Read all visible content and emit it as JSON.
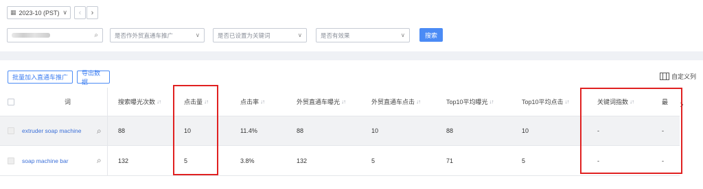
{
  "filters": {
    "date_label": "2023-10 (PST)",
    "overseas_promo": "是否作外贸直通车推广",
    "set_keyword": "是否已设置为关键词",
    "effective": "是否有效果",
    "search_button": "搜索"
  },
  "toolbar": {
    "batch_add": "批量加入直通车推广",
    "export": "导出数据",
    "custom_columns": "自定义列"
  },
  "table": {
    "headers": {
      "word": "词",
      "impressions": "搜索曝光次数",
      "clicks": "点击量",
      "ctr": "点击率",
      "p4p_impressions": "外贸直通车曝光",
      "p4p_clicks": "外贸直通车点击",
      "top10_impr": "Top10平均曝光",
      "top10_clicks": "Top10平均点击",
      "kw_index": "关键词指数",
      "truncated": "最"
    },
    "sort_glyph": "↓↑",
    "rows": [
      {
        "word": "extruder soap machine",
        "impressions": "88",
        "clicks": "10",
        "ctr": "11.4%",
        "p4p_impressions": "88",
        "p4p_clicks": "10",
        "top10_impr": "88",
        "top10_clicks": "10",
        "kw_index": "-",
        "last": "-"
      },
      {
        "word": "soap machine bar",
        "impressions": "132",
        "clicks": "5",
        "ctr": "3.8%",
        "p4p_impressions": "132",
        "p4p_clicks": "5",
        "top10_impr": "71",
        "top10_clicks": "5",
        "kw_index": "-",
        "last": "-"
      }
    ]
  },
  "colors": {
    "primary": "#4b8bf5",
    "link": "#3b6fd8",
    "highlight_box": "#e02020",
    "band": "#eff1f5"
  }
}
